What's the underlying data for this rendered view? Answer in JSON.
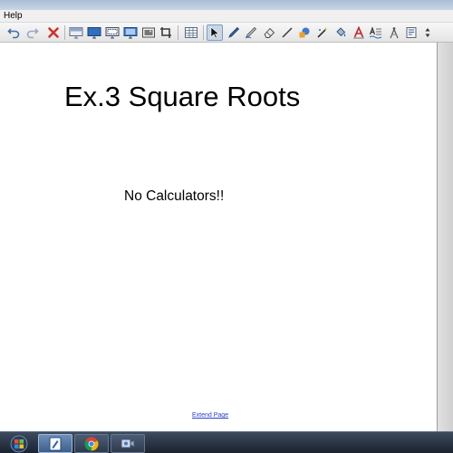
{
  "menubar": {
    "items": [
      {
        "label": "Help"
      }
    ]
  },
  "toolbar": {
    "buttons": [
      {
        "name": "undo-icon"
      },
      {
        "name": "redo-icon"
      },
      {
        "name": "delete-icon"
      },
      {
        "name": "screen-shade-icon"
      },
      {
        "name": "show-desktop-icon"
      },
      {
        "name": "screen-capture-icon"
      },
      {
        "name": "monitor-icon"
      },
      {
        "name": "insert-image-icon"
      },
      {
        "name": "crop-icon"
      },
      {
        "name": "table-icon"
      },
      {
        "name": "select-pointer-icon"
      },
      {
        "name": "pen-icon"
      },
      {
        "name": "creative-pen-icon"
      },
      {
        "name": "eraser-icon"
      },
      {
        "name": "line-icon"
      },
      {
        "name": "shape-icon"
      },
      {
        "name": "magic-pen-icon"
      },
      {
        "name": "fill-icon"
      },
      {
        "name": "text-icon"
      },
      {
        "name": "handwriting-recognition-icon"
      },
      {
        "name": "measure-tool-icon"
      },
      {
        "name": "properties-icon"
      },
      {
        "name": "toolbar-arrows-icon"
      }
    ]
  },
  "page": {
    "title": "Ex.3 Square Roots",
    "note": "No Calculators!!",
    "extend_link": "Extend Page"
  },
  "taskbar": {
    "items": [
      {
        "name": "start-button-icon"
      },
      {
        "name": "notebook-app-icon"
      },
      {
        "name": "chrome-icon"
      },
      {
        "name": "screen-recorder-icon"
      }
    ]
  }
}
